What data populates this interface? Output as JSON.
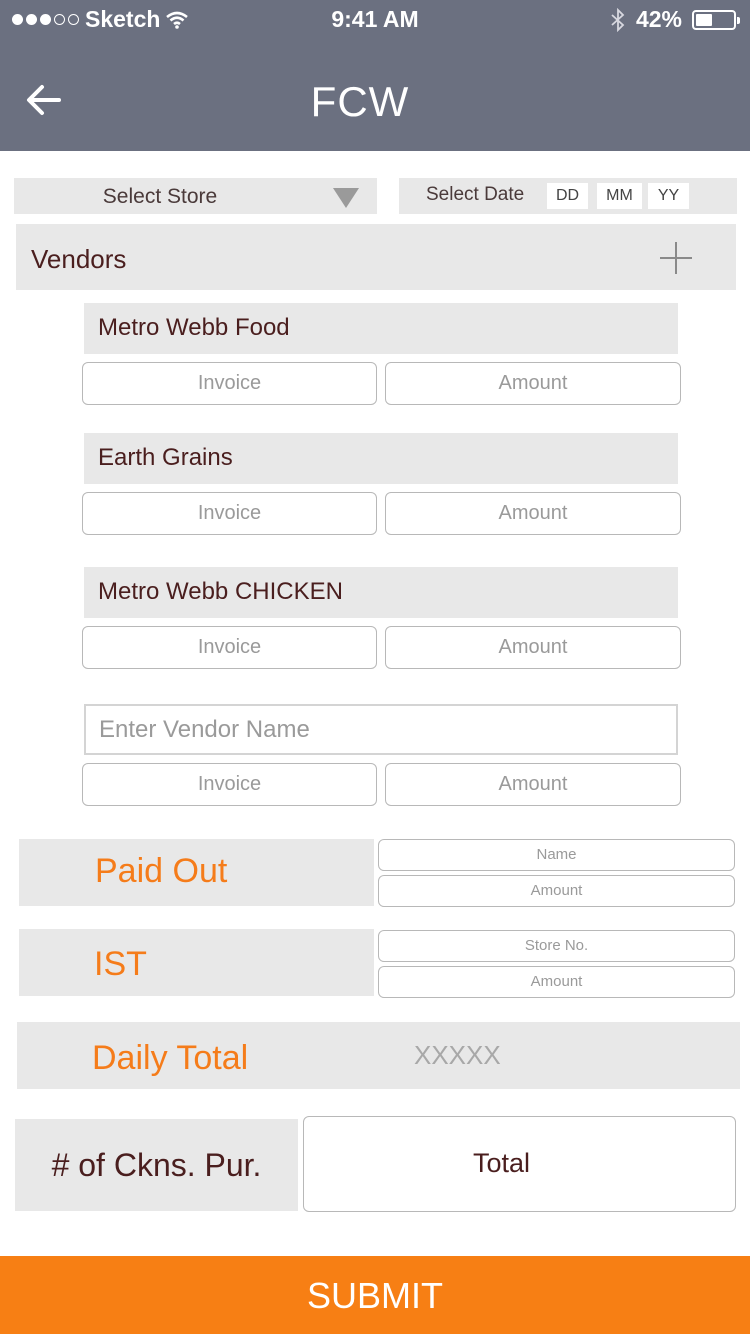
{
  "status_bar": {
    "carrier": "Sketch",
    "time": "9:41 AM",
    "battery": "42%"
  },
  "header": {
    "title": "FCW"
  },
  "filters": {
    "store_label": "Select Store",
    "date_label": "Select Date",
    "date_parts": [
      "DD",
      "MM",
      "YY"
    ]
  },
  "vendors": {
    "label": "Vendors",
    "items": [
      {
        "name": "Metro Webb Food",
        "invoice_placeholder": "Invoice",
        "amount_placeholder": "Amount"
      },
      {
        "name": "Earth Grains",
        "invoice_placeholder": "Invoice",
        "amount_placeholder": "Amount"
      },
      {
        "name": "Metro Webb CHICKEN",
        "invoice_placeholder": "Invoice",
        "amount_placeholder": "Amount"
      }
    ],
    "new_vendor": {
      "name_placeholder": "Enter Vendor Name",
      "invoice_placeholder": "Invoice",
      "amount_placeholder": "Amount"
    }
  },
  "paid_out": {
    "label": "Paid Out",
    "name_placeholder": "Name",
    "amount_placeholder": "Amount"
  },
  "ist": {
    "label": "IST",
    "store_placeholder": "Store No.",
    "amount_placeholder": "Amount"
  },
  "daily_total": {
    "label": "Daily Total",
    "value": "XXXXX"
  },
  "chickens": {
    "label": "# of Ckns. Pur.",
    "total_placeholder": "Total"
  },
  "submit_label": "SUBMIT",
  "colors": {
    "header_bg": "#6b7080",
    "accent": "#f77f14",
    "panel": "#e8e8e8"
  }
}
